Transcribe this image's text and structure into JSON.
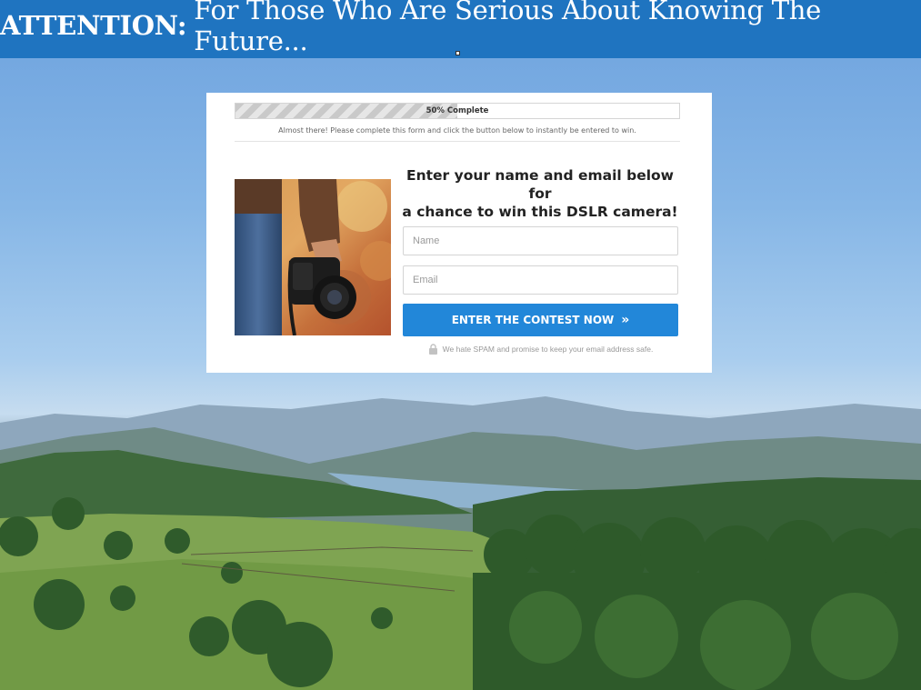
{
  "banner": {
    "strong": "ATTENTION:",
    "rest": "For Those Who Are Serious About Knowing The Future..."
  },
  "popup": {
    "progress": {
      "label": "50% Complete",
      "fraction": 0.5
    },
    "note": "Almost there! Please complete this form and click the button below to instantly be entered to win.",
    "headline_line1": "Enter your name and email below for",
    "headline_line2": "a chance to win this DSLR camera!",
    "form": {
      "name_placeholder": "Name",
      "email_placeholder": "Email",
      "submit_label": "ENTER THE CONTEST NOW",
      "submit_icon": "double-chevron-right-icon"
    },
    "spam_note": "We hate SPAM and promise to keep your email address safe.",
    "spam_icon": "lock-icon"
  },
  "colors": {
    "banner": "#1f74c0",
    "cta": "#2287d9",
    "sky": "#86b6e6"
  }
}
